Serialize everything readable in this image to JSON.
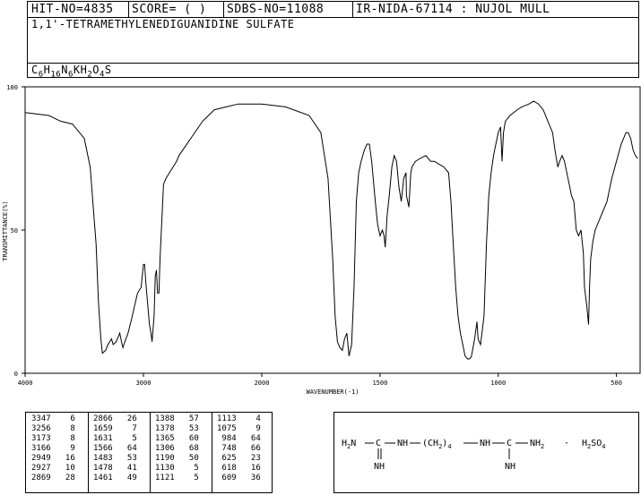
{
  "header": {
    "hit_no": "HIT-NO=4835",
    "score": "SCORE=  (   )",
    "sdbs_no": "SDBS-NO=11088",
    "ir_info": "IR-NIDA-67114 : NUJOL MULL",
    "compound_name": "1,1'-TETRAMETHYLENEDIGUANIDINE SULFATE",
    "formula_parts": [
      [
        "C",
        ""
      ],
      [
        "6",
        ""
      ],
      [
        "H",
        ""
      ],
      [
        "16",
        ""
      ],
      [
        "N",
        ""
      ],
      [
        "6",
        ""
      ],
      [
        "KH",
        ""
      ],
      [
        "2",
        ""
      ],
      [
        "O",
        ""
      ],
      [
        "4",
        ""
      ],
      [
        "S",
        ""
      ]
    ]
  },
  "formula_display": {
    "segments": [
      {
        "t": "C",
        "sub": false
      },
      {
        "t": "6",
        "sub": true
      },
      {
        "t": "H",
        "sub": false
      },
      {
        "t": "16",
        "sub": true
      },
      {
        "t": "N",
        "sub": false
      },
      {
        "t": "6",
        "sub": true
      },
      {
        "t": "KH",
        "sub": false
      },
      {
        "t": "2",
        "sub": true
      },
      {
        "t": "O",
        "sub": false
      },
      {
        "t": "4",
        "sub": true
      },
      {
        "t": "S",
        "sub": false
      }
    ]
  },
  "chart_data": {
    "type": "line",
    "xlabel": "WAVENUMBER(-1)",
    "ylabel": "TRANSMITTANCE(%)",
    "xlim": [
      4000,
      400
    ],
    "ylim": [
      0,
      100
    ],
    "x_ticks": [
      "4000",
      "3000",
      "2000",
      "1500",
      "1000",
      "500"
    ],
    "y_ticks": [
      "0",
      "50",
      "100"
    ],
    "series": [
      {
        "points": [
          [
            4000,
            91
          ],
          [
            3800,
            90
          ],
          [
            3700,
            88
          ],
          [
            3600,
            87
          ],
          [
            3500,
            82
          ],
          [
            3450,
            72
          ],
          [
            3400,
            45
          ],
          [
            3380,
            25
          ],
          [
            3360,
            12
          ],
          [
            3347,
            7
          ],
          [
            3320,
            8
          ],
          [
            3300,
            10
          ],
          [
            3270,
            12
          ],
          [
            3256,
            10
          ],
          [
            3230,
            11
          ],
          [
            3200,
            14
          ],
          [
            3180,
            10
          ],
          [
            3173,
            9
          ],
          [
            3166,
            10
          ],
          [
            3130,
            14
          ],
          [
            3100,
            19
          ],
          [
            3050,
            28
          ],
          [
            3020,
            30
          ],
          [
            3000,
            38
          ],
          [
            2990,
            38
          ],
          [
            2980,
            32
          ],
          [
            2960,
            22
          ],
          [
            2949,
            17
          ],
          [
            2940,
            15
          ],
          [
            2930,
            12
          ],
          [
            2927,
            11
          ],
          [
            2910,
            20
          ],
          [
            2900,
            34
          ],
          [
            2890,
            36
          ],
          [
            2880,
            28
          ],
          [
            2869,
            28
          ],
          [
            2860,
            40
          ],
          [
            2830,
            66
          ],
          [
            2810,
            68
          ],
          [
            2780,
            70
          ],
          [
            2750,
            72
          ],
          [
            2720,
            74
          ],
          [
            2700,
            76
          ],
          [
            2650,
            79
          ],
          [
            2600,
            82
          ],
          [
            2550,
            85
          ],
          [
            2500,
            88
          ],
          [
            2450,
            90
          ],
          [
            2400,
            92
          ],
          [
            2300,
            93
          ],
          [
            2200,
            94
          ],
          [
            2100,
            94
          ],
          [
            2000,
            94
          ],
          [
            1900,
            93
          ],
          [
            1800,
            90
          ],
          [
            1750,
            84
          ],
          [
            1720,
            68
          ],
          [
            1700,
            40
          ],
          [
            1690,
            20
          ],
          [
            1680,
            11
          ],
          [
            1670,
            9
          ],
          [
            1659,
            8
          ],
          [
            1650,
            12
          ],
          [
            1640,
            14
          ],
          [
            1631,
            6
          ],
          [
            1620,
            10
          ],
          [
            1610,
            30
          ],
          [
            1600,
            60
          ],
          [
            1590,
            70
          ],
          [
            1580,
            74
          ],
          [
            1566,
            78
          ],
          [
            1555,
            80
          ],
          [
            1545,
            80
          ],
          [
            1535,
            74
          ],
          [
            1520,
            60
          ],
          [
            1510,
            52
          ],
          [
            1500,
            48
          ],
          [
            1490,
            50
          ],
          [
            1483,
            48
          ],
          [
            1478,
            44
          ],
          [
            1470,
            55
          ],
          [
            1461,
            62
          ],
          [
            1450,
            72
          ],
          [
            1440,
            76
          ],
          [
            1430,
            74
          ],
          [
            1420,
            65
          ],
          [
            1410,
            60
          ],
          [
            1400,
            68
          ],
          [
            1390,
            70
          ],
          [
            1388,
            62
          ],
          [
            1378,
            58
          ],
          [
            1370,
            70
          ],
          [
            1365,
            72
          ],
          [
            1350,
            74
          ],
          [
            1330,
            75
          ],
          [
            1306,
            76
          ],
          [
            1286,
            74
          ],
          [
            1270,
            74
          ],
          [
            1250,
            73
          ],
          [
            1230,
            72
          ],
          [
            1210,
            70
          ],
          [
            1200,
            60
          ],
          [
            1190,
            45
          ],
          [
            1180,
            30
          ],
          [
            1170,
            20
          ],
          [
            1160,
            14
          ],
          [
            1150,
            10
          ],
          [
            1140,
            6
          ],
          [
            1130,
            5
          ],
          [
            1121,
            5
          ],
          [
            1113,
            6
          ],
          [
            1100,
            12
          ],
          [
            1090,
            18
          ],
          [
            1085,
            12
          ],
          [
            1075,
            10
          ],
          [
            1060,
            20
          ],
          [
            1050,
            45
          ],
          [
            1040,
            62
          ],
          [
            1030,
            70
          ],
          [
            1020,
            76
          ],
          [
            1010,
            80
          ],
          [
            1000,
            84
          ],
          [
            990,
            86
          ],
          [
            984,
            74
          ],
          [
            978,
            84
          ],
          [
            970,
            88
          ],
          [
            950,
            90
          ],
          [
            920,
            92
          ],
          [
            900,
            93
          ],
          [
            870,
            94
          ],
          [
            850,
            95
          ],
          [
            830,
            94
          ],
          [
            810,
            92
          ],
          [
            790,
            88
          ],
          [
            770,
            84
          ],
          [
            760,
            78
          ],
          [
            748,
            72
          ],
          [
            740,
            74
          ],
          [
            730,
            76
          ],
          [
            720,
            74
          ],
          [
            700,
            66
          ],
          [
            690,
            62
          ],
          [
            680,
            60
          ],
          [
            670,
            50
          ],
          [
            660,
            48
          ],
          [
            650,
            50
          ],
          [
            640,
            42
          ],
          [
            635,
            30
          ],
          [
            625,
            23
          ],
          [
            618,
            17
          ],
          [
            614,
            30
          ],
          [
            609,
            40
          ],
          [
            600,
            46
          ],
          [
            590,
            50
          ],
          [
            580,
            52
          ],
          [
            560,
            56
          ],
          [
            540,
            60
          ],
          [
            520,
            68
          ],
          [
            500,
            74
          ],
          [
            480,
            80
          ],
          [
            460,
            84
          ],
          [
            450,
            84
          ],
          [
            440,
            82
          ],
          [
            430,
            78
          ],
          [
            420,
            76
          ],
          [
            410,
            75
          ]
        ]
      }
    ],
    "peak_table": [
      [
        [
          "3347",
          "6"
        ],
        [
          "3256",
          "8"
        ],
        [
          "3173",
          "8"
        ],
        [
          "3166",
          "9"
        ],
        [
          "2949",
          "16"
        ],
        [
          "2927",
          "10"
        ],
        [
          "2869",
          "28"
        ]
      ],
      [
        [
          "2866",
          "26"
        ],
        [
          "1659",
          "7"
        ],
        [
          "1631",
          "5"
        ],
        [
          "1566",
          "64"
        ],
        [
          "1483",
          "53"
        ],
        [
          "1478",
          "41"
        ],
        [
          "1461",
          "49"
        ]
      ],
      [
        [
          "1388",
          "57"
        ],
        [
          "1378",
          "53"
        ],
        [
          "1365",
          "60"
        ],
        [
          "1306",
          "68"
        ],
        [
          "1190",
          "50"
        ],
        [
          "1130",
          "5"
        ],
        [
          "1121",
          "5"
        ]
      ],
      [
        [
          "1113",
          "4"
        ],
        [
          "1075",
          "9"
        ],
        [
          "984",
          "64"
        ],
        [
          "748",
          "66"
        ],
        [
          "625",
          "23"
        ],
        [
          "618",
          "16"
        ],
        [
          "609",
          "36"
        ]
      ]
    ]
  },
  "structure": {
    "h2n_left": "H",
    "h2n_left_sub": "2",
    "h2n_left_n": "N",
    "c1": "C",
    "nh1": "NH",
    "ch2": "(CH",
    "ch2_sub": "2",
    "ch2_close": ")",
    "ch2_count": "4",
    "nh2": "NH",
    "c2": "C",
    "nh2r": "NH",
    "nh2r_sub": "2",
    "imine1": "NH",
    "imine2": "NH",
    "dot": "·",
    "acid": "H",
    "acid_sub1": "2",
    "acid_mid": "SO",
    "acid_sub2": "4"
  }
}
